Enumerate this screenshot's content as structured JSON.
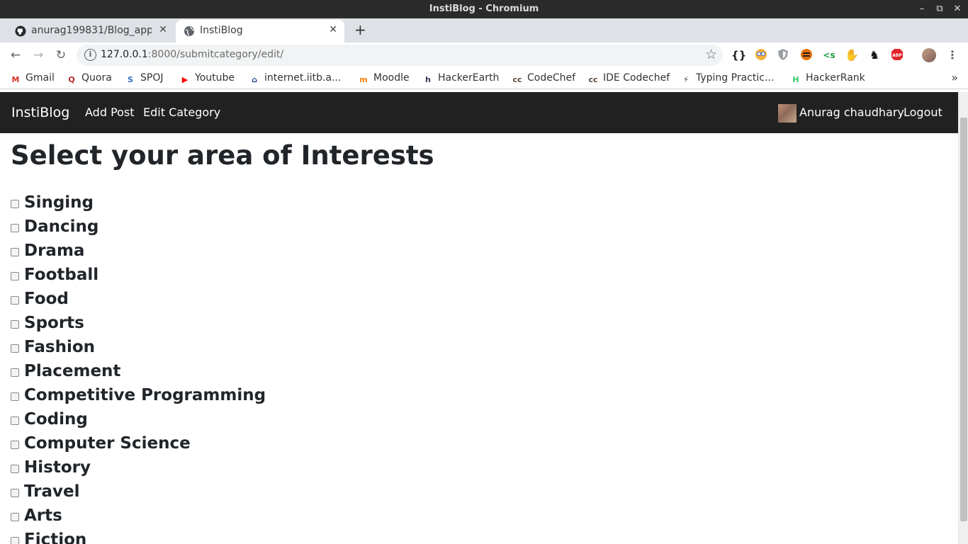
{
  "window": {
    "title": "InstiBlog - Chromium"
  },
  "tabs": [
    {
      "label": "anurag199831/Blog_app:"
    },
    {
      "label": "InstiBlog"
    }
  ],
  "address_bar": {
    "host": "127.0.0.1",
    "path": ":8000/submitcategory/edit/"
  },
  "bookmarks": [
    {
      "label": "Gmail",
      "icon": "gmail-icon",
      "glyph": "M",
      "color": "#d93025"
    },
    {
      "label": "Quora",
      "icon": "quora-icon",
      "glyph": "Q",
      "color": "#b92b27"
    },
    {
      "label": "SPOJ",
      "icon": "spoj-icon",
      "glyph": "S",
      "color": "#2f6fc9"
    },
    {
      "label": "Youtube",
      "icon": "youtube-icon",
      "glyph": "▶",
      "color": "#ff0000"
    },
    {
      "label": "internet.iitb.a...",
      "icon": "iitb-icon",
      "glyph": "⌂",
      "color": "#1e3a8a"
    },
    {
      "label": "Moodle",
      "icon": "moodle-icon",
      "glyph": "m",
      "color": "#f98012"
    },
    {
      "label": "HackerEarth",
      "icon": "hackerearth-icon",
      "glyph": "h",
      "color": "#323754"
    },
    {
      "label": "CodeChef",
      "icon": "codechef-icon",
      "glyph": "cc",
      "color": "#5b4638"
    },
    {
      "label": "IDE Codechef",
      "icon": "codechef-icon",
      "glyph": "cc",
      "color": "#5b4638"
    },
    {
      "label": "Typing Practic...",
      "icon": "lightning-icon",
      "glyph": "⚡",
      "color": "#333333"
    },
    {
      "label": "HackerRank",
      "icon": "hackerrank-icon",
      "glyph": "H",
      "color": "#2ec866"
    }
  ],
  "navbar": {
    "brand": "InstiBlog",
    "links": [
      "Add Post",
      "Edit Category"
    ],
    "user_name": "Anurag chaudhary",
    "logout": "Logout"
  },
  "page": {
    "heading": "Select your area of Interests",
    "categories": [
      "Singing",
      "Dancing",
      "Drama",
      "Football",
      "Food",
      "Sports",
      "Fashion",
      "Placement",
      "Competitive Programming",
      "Coding",
      "Computer Science",
      "History",
      "Travel",
      "Arts",
      "Fiction"
    ]
  }
}
